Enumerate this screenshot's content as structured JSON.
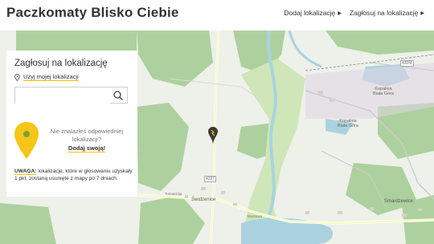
{
  "header": {
    "logo": "Paczkomaty Blisko Ciebie",
    "nav": [
      {
        "label": "Dodaj lokalizację"
      },
      {
        "label": "Zagłosuj na lokalizację"
      }
    ]
  },
  "panel": {
    "title": "Zagłosuj na lokalizację",
    "use_location": "Użyj mojej lokalizacji",
    "search_value": "",
    "search_placeholder": "",
    "not_found_text": "Nie znalazłeś odpowiedniej lokalizacji?",
    "add_link": "Dodaj swoją!",
    "warning_label": "UWAGA:",
    "warning_text": "lokalizacje, które w głosowaniu uzyskały 1 pkt, zostaną usunięte z mapy po 7 dniach."
  },
  "map": {
    "labels": [
      {
        "text": "432M"
      },
      {
        "text": "Kopalnia Biała Góra"
      },
      {
        "text": "Kopalnia Biała Góra"
      },
      {
        "text": "432T"
      },
      {
        "text": "Świdzenice"
      },
      {
        "text": "Smardzewice"
      },
      {
        "text": "Mostowa"
      },
      {
        "text": "Tomaszów"
      }
    ]
  },
  "colors": {
    "accent": "#f2c200",
    "forest": "#add19e",
    "water": "#aad3df",
    "road_major": "#f7fabf"
  },
  "icons": {
    "location": "location-pin-icon",
    "search": "magnifier-icon",
    "nav_caret": "caret-right-icon",
    "marker": "parcel-locker-marker-icon",
    "big_pin": "yellow-map-pin-icon"
  }
}
